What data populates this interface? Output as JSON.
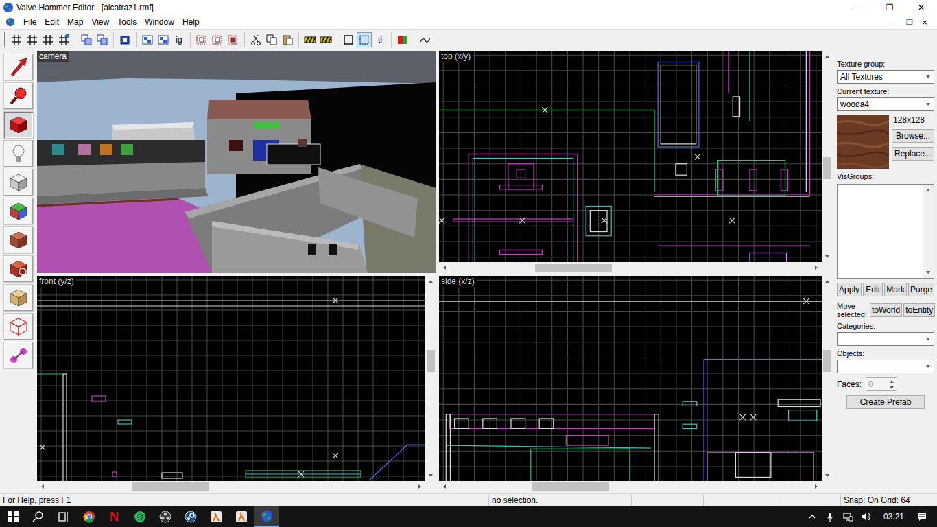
{
  "window": {
    "title": "Valve Hammer Editor - [alcatraz1.rmf]",
    "controls": [
      "—",
      "❐",
      "✕"
    ]
  },
  "menu": [
    "File",
    "Edit",
    "Map",
    "View",
    "Tools",
    "Window",
    "Help"
  ],
  "mdi_controls": [
    "–",
    "❐",
    "×"
  ],
  "toolbar": [
    [
      {
        "kind": "grid",
        "selected": false
      },
      {
        "kind": "grid",
        "selected": false
      },
      {
        "kind": "grid",
        "selected": false
      },
      {
        "kind": "grid-plus",
        "selected": false
      }
    ],
    [
      {
        "kind": "layers",
        "selected": false
      },
      {
        "kind": "layers",
        "selected": false
      }
    ],
    [
      {
        "kind": "entity",
        "selected": false
      }
    ],
    [
      {
        "kind": "views",
        "selected": false
      },
      {
        "kind": "views",
        "selected": false
      },
      {
        "kind": "text",
        "label": "ig",
        "selected": false
      }
    ],
    [
      {
        "kind": "group",
        "selected": false
      },
      {
        "kind": "group",
        "selected": false
      },
      {
        "kind": "ungroup",
        "selected": false
      }
    ],
    [
      {
        "kind": "cut",
        "selected": false
      },
      {
        "kind": "copy",
        "selected": false
      },
      {
        "kind": "paste",
        "selected": false
      }
    ],
    [
      {
        "kind": "hazard",
        "selected": false
      },
      {
        "kind": "hazard",
        "selected": false
      }
    ],
    [
      {
        "kind": "bbox",
        "selected": false
      },
      {
        "kind": "select",
        "selected": true
      },
      {
        "kind": "text",
        "label": "tl",
        "selected": false
      }
    ],
    [
      {
        "kind": "carve",
        "selected": false
      }
    ],
    [
      {
        "kind": "misc",
        "selected": false
      }
    ]
  ],
  "tools": [
    {
      "kind": "select",
      "selected": false
    },
    {
      "kind": "magnify",
      "selected": false
    },
    {
      "kind": "camera",
      "selected": true
    },
    {
      "kind": "entity",
      "selected": false
    },
    {
      "kind": "block",
      "selected": false
    },
    {
      "kind": "texture",
      "selected": false
    },
    {
      "kind": "apply-texture",
      "selected": false
    },
    {
      "kind": "decal",
      "selected": false
    },
    {
      "kind": "clip",
      "selected": false
    },
    {
      "kind": "vertex",
      "selected": false
    },
    {
      "kind": "path",
      "selected": false
    }
  ],
  "viewports": [
    {
      "label": "camera",
      "kind": "camera"
    },
    {
      "label": "top (x/y)",
      "kind": "top",
      "scroll_x": 0.3,
      "scroll_y": 0.57
    },
    {
      "label": "front (y/z)",
      "kind": "front",
      "scroll_x": 0.29,
      "scroll_y": 0.39
    },
    {
      "label": "side (x/z)",
      "kind": "side",
      "scroll_x": 0.29,
      "scroll_y": 0.39
    }
  ],
  "texture_panel": {
    "group_label": "Texture group:",
    "group_value": "All Textures",
    "current_label": "Current texture:",
    "current_value": "wooda4",
    "size": "128x128",
    "browse": "Browse...",
    "replace": "Replace...",
    "visgroups_label": "VisGroups:",
    "visgroups": [],
    "visgroup_buttons": [
      "Apply",
      "Edit",
      "Mark",
      "Purge"
    ],
    "move_label": "Move selected:",
    "move_buttons": [
      "toWorld",
      "toEntity"
    ],
    "categories_label": "Categories:",
    "categories_value": "",
    "objects_label": "Objects:",
    "objects_value": "",
    "faces_label": "Faces:",
    "faces_value": "0",
    "faces_disabled": true,
    "prefab_button": "Create Prefab"
  },
  "status_bar": [
    "For Help, press F1",
    "no selection.",
    "",
    "",
    "",
    "Snap: On Grid: 64"
  ],
  "taskbar": {
    "apps": [
      {
        "kind": "start",
        "selected": false
      },
      {
        "kind": "search",
        "selected": false
      },
      {
        "kind": "taskview",
        "selected": false
      },
      {
        "kind": "chrome",
        "selected": false
      },
      {
        "kind": "netflix",
        "label": "N",
        "selected": false
      },
      {
        "kind": "spotify",
        "selected": false
      },
      {
        "kind": "obs",
        "selected": false
      },
      {
        "kind": "steam",
        "selected": false
      },
      {
        "kind": "halflife",
        "selected": false
      },
      {
        "kind": "halflife",
        "selected": false
      },
      {
        "kind": "hammer",
        "selected": true
      }
    ],
    "tray": [
      "chevron",
      "mic",
      "network",
      "volume"
    ],
    "time": "03:21"
  }
}
